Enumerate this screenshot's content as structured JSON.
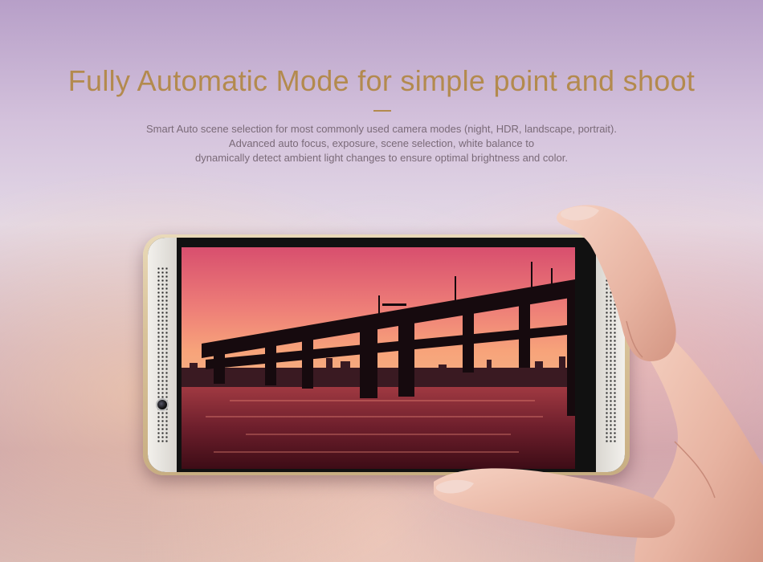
{
  "hero": {
    "title": "Fully Automatic Mode for simple point and shoot",
    "description_lines": [
      "Smart Auto scene selection for most commonly used camera modes (night, HDR, landscape, portrait).",
      "Advanced auto focus, exposure, scene selection, white balance to",
      "dynamically detect ambient light changes to ensure optimal brightness and color."
    ]
  },
  "colors": {
    "title": "#b38a4e",
    "body_text": "#7a6a78",
    "phone_gold": "#d9c39a",
    "sky_top": "#e6607a",
    "sky_horizon": "#f4a07a"
  },
  "icons": {
    "front_camera": "camera-lens-icon",
    "speaker": "speaker-grille-icon"
  }
}
